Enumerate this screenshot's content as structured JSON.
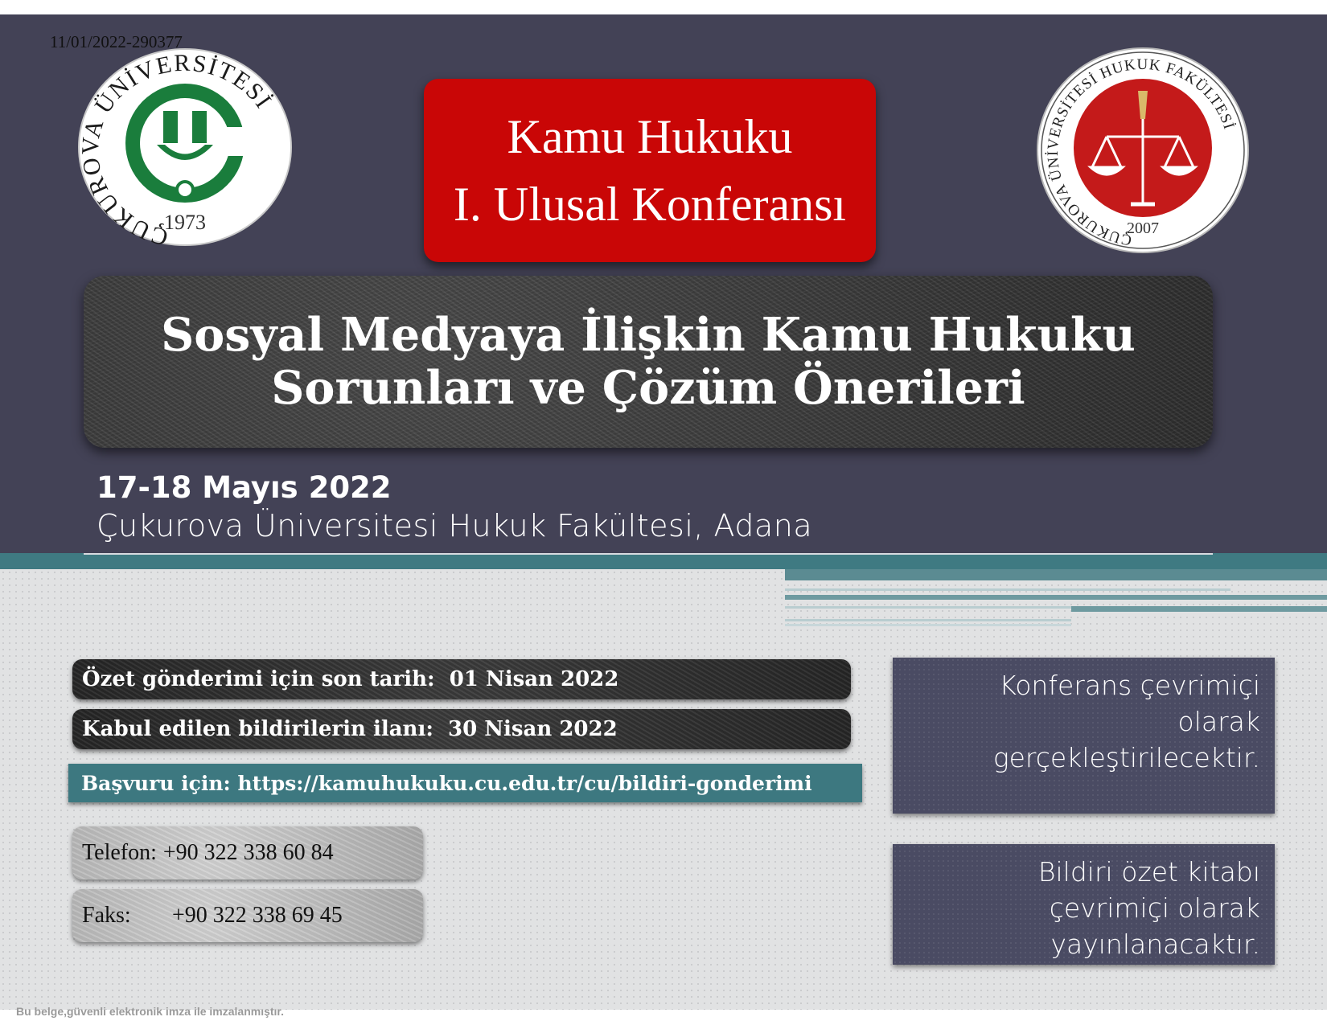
{
  "document_number": "11/01/2022-290377",
  "logos": {
    "left": {
      "ring_text": "ÇUKUROVA ÜNİVERSİTESİ",
      "year": "1973"
    },
    "right": {
      "ring_text": "ÇUKUROVA ÜNİVERSİTESİ HUKUK FAKÜLTESİ",
      "year": "2007"
    }
  },
  "header": {
    "line1": "Kamu Hukuku",
    "line2": "I. Ulusal Konferansı"
  },
  "title": {
    "line1": "Sosyal Medyaya İlişkin Kamu Hukuku",
    "line2": "Sorunları ve Çözüm Önerileri"
  },
  "event": {
    "dates": "17-18 Mayıs 2022",
    "venue": "Çukurova Üniversitesi Hukuk Fakültesi, Adana"
  },
  "deadlines": [
    {
      "text": "Özet gönderimi için son tarih:  01 Nisan 2022"
    },
    {
      "text": "Kabul edilen bildirilerin ilanı:  30 Nisan 2022"
    }
  ],
  "application": {
    "text": "Başvuru için: https://kamuhukuku.cu.edu.tr/cu/bildiri-gonderimi"
  },
  "contact": {
    "phone_label": "Telefon:",
    "phone_value": "+90 322 338 60 84",
    "fax_label": "Faks:",
    "fax_value": "+90 322 338 69 45"
  },
  "info_boxes": [
    {
      "lines": [
        "Konferans çevrimiçi",
        "olarak",
        "gerçekleştirilecektir."
      ]
    },
    {
      "lines": [
        "Bildiri özet kitabı",
        "çevrimiçi olarak",
        "yayınlanacaktır."
      ]
    }
  ],
  "footer": {
    "signature_note": "Bu belge,güvenli elektronik imza ile imzalanmıştır."
  },
  "colors": {
    "top_panel": "#434256",
    "red_box": "#c90606",
    "teal": "#3f7a82",
    "info_box": "#4a4b63",
    "logo_green": "#1a7d3c",
    "logo_red": "#c41a1a"
  }
}
